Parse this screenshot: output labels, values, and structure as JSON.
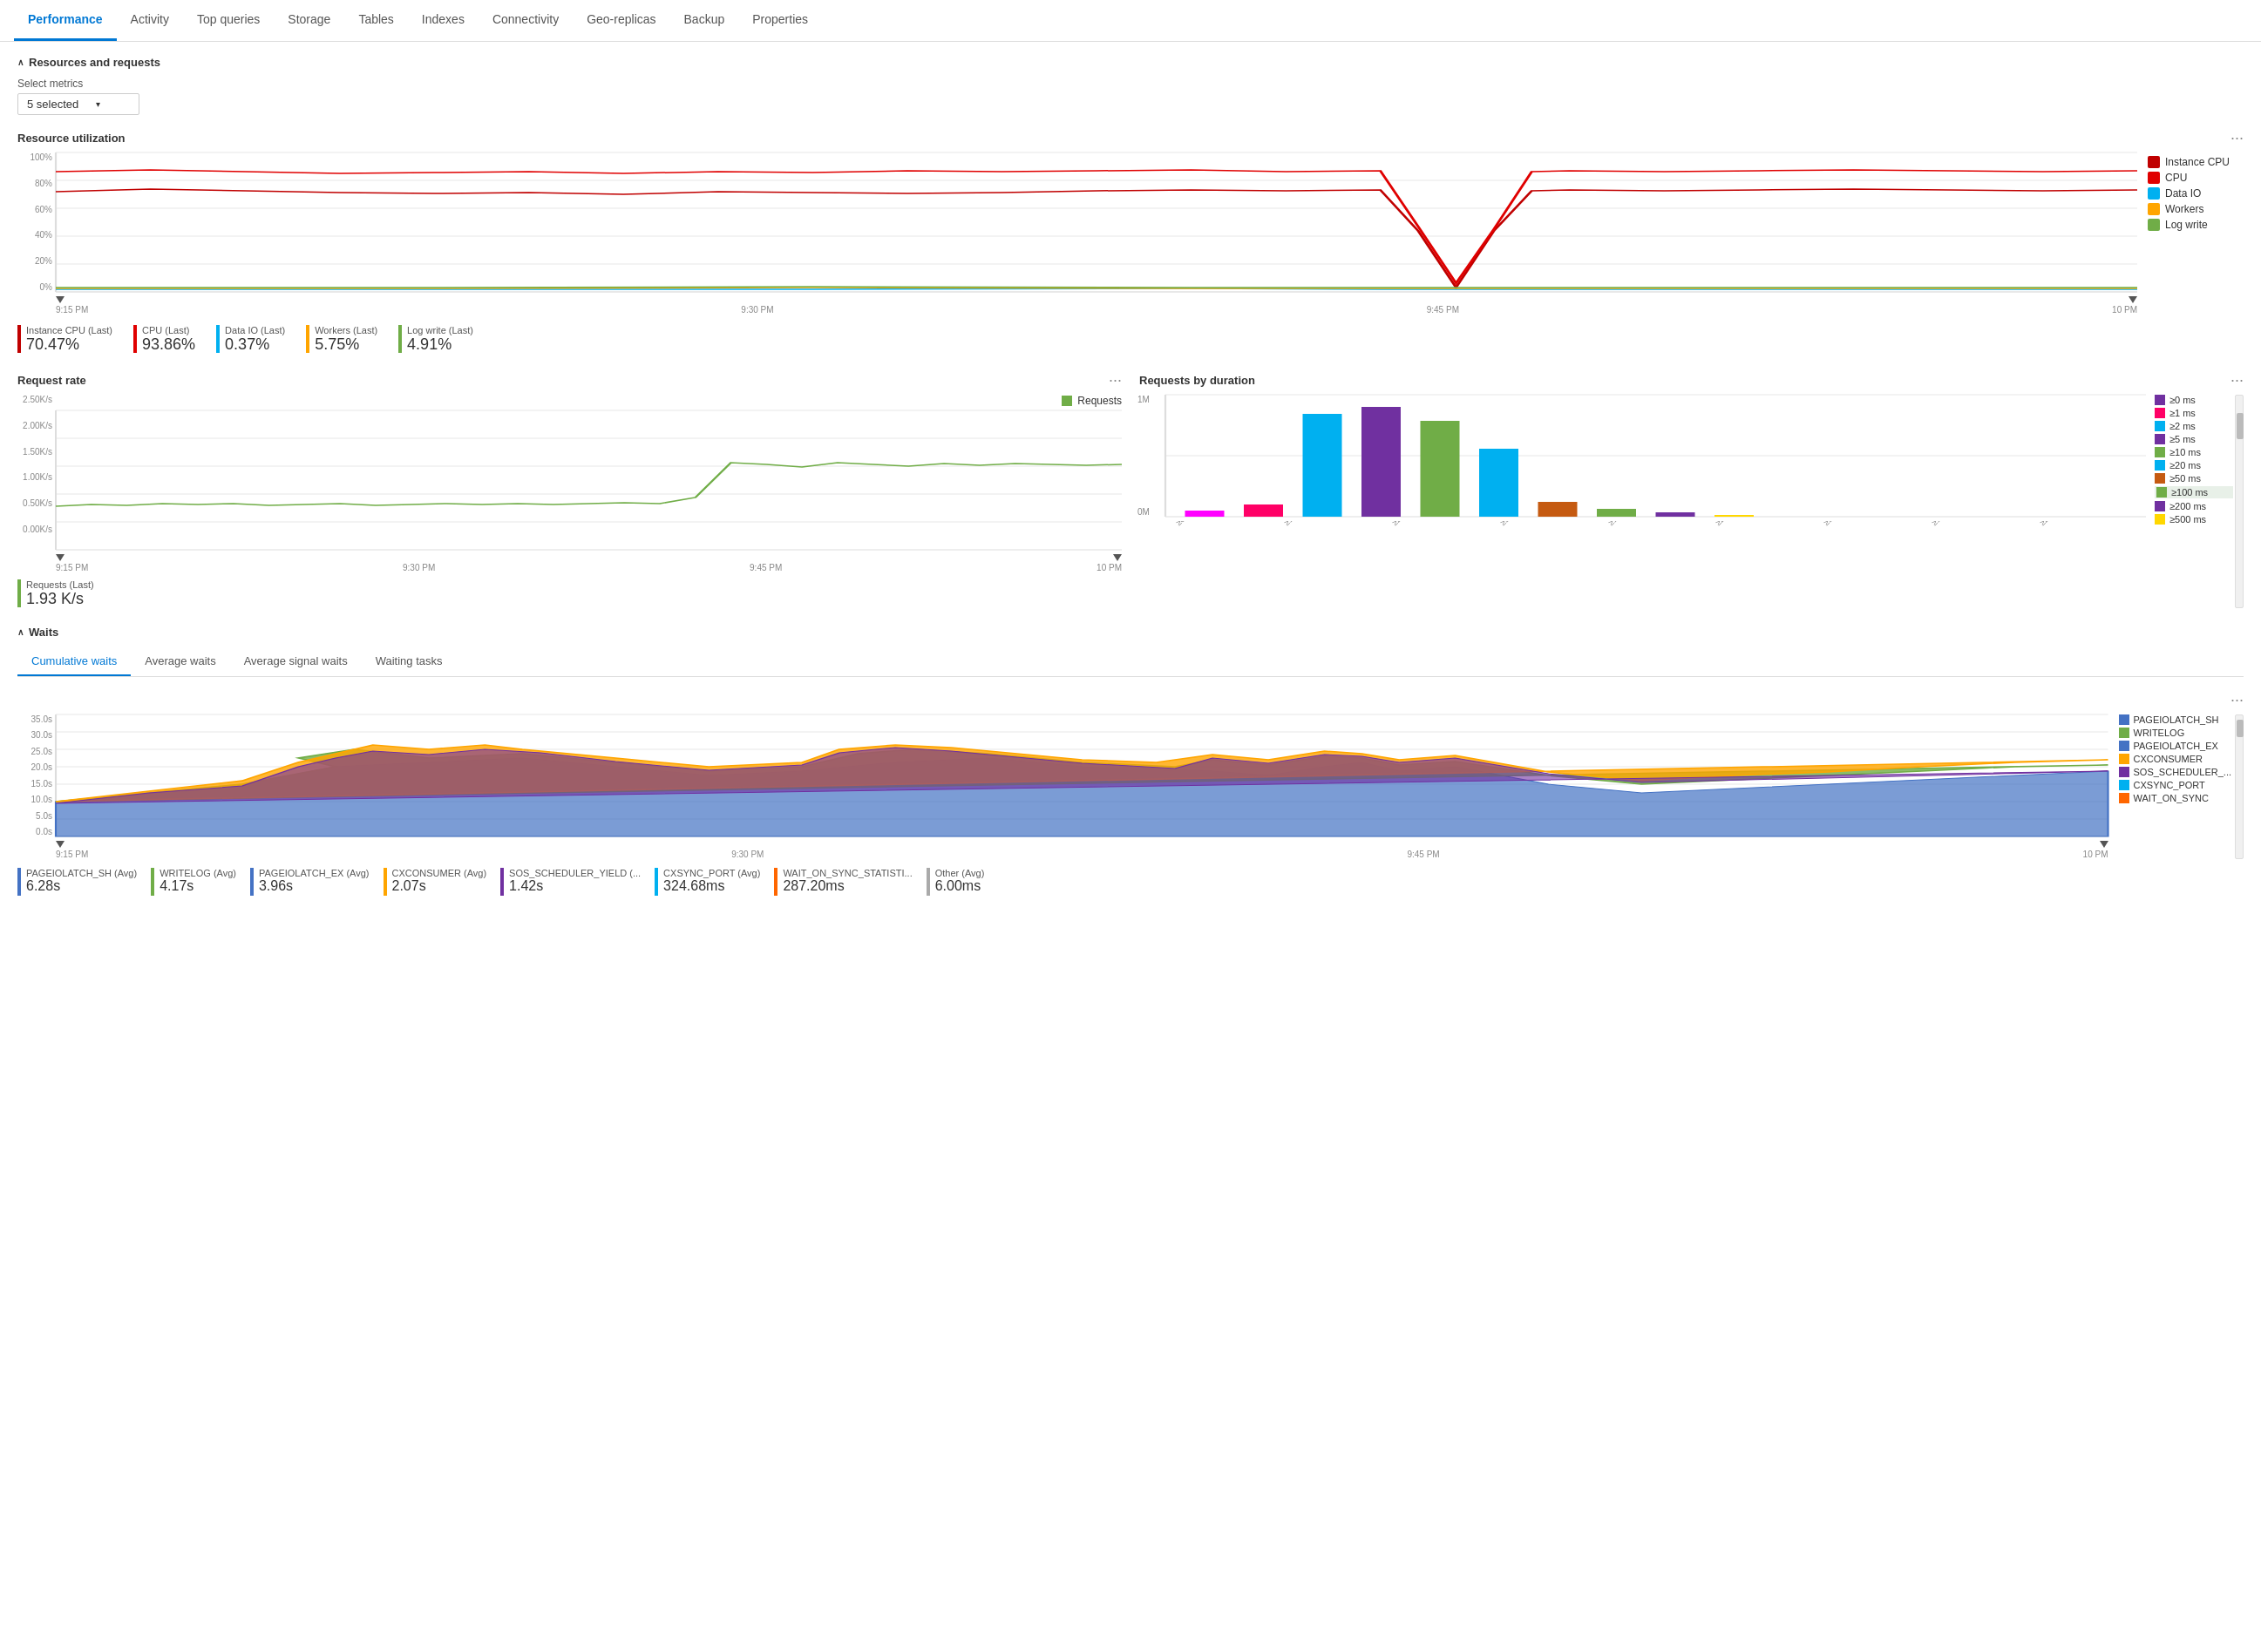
{
  "nav": {
    "tabs": [
      {
        "label": "Performance",
        "active": true
      },
      {
        "label": "Activity",
        "active": false
      },
      {
        "label": "Top queries",
        "active": false
      },
      {
        "label": "Storage",
        "active": false
      },
      {
        "label": "Tables",
        "active": false
      },
      {
        "label": "Indexes",
        "active": false
      },
      {
        "label": "Connectivity",
        "active": false
      },
      {
        "label": "Geo-replicas",
        "active": false
      },
      {
        "label": "Backup",
        "active": false
      },
      {
        "label": "Properties",
        "active": false
      }
    ]
  },
  "resources_section": {
    "title": "Resources and requests",
    "select_label": "Select metrics",
    "select_value": "5 selected"
  },
  "resource_utilization": {
    "title": "Resource utilization",
    "y_labels": [
      "100%",
      "80%",
      "60%",
      "40%",
      "20%",
      "0%"
    ],
    "x_labels": [
      "9:15 PM",
      "9:30 PM",
      "9:45 PM",
      "10 PM"
    ],
    "legend": [
      {
        "label": "Instance CPU",
        "color": "#c00000"
      },
      {
        "label": "CPU",
        "color": "#e00000"
      },
      {
        "label": "Data IO",
        "color": "#00b0f0"
      },
      {
        "label": "Workers",
        "color": "#ffa500"
      },
      {
        "label": "Log write",
        "color": "#70ad47"
      }
    ],
    "metrics": [
      {
        "label": "Instance CPU (Last)",
        "value": "70.47",
        "unit": "%",
        "color": "#c00000"
      },
      {
        "label": "CPU (Last)",
        "value": "93.86",
        "unit": "%",
        "color": "#e00000"
      },
      {
        "label": "Data IO (Last)",
        "value": "0.37",
        "unit": "%",
        "color": "#00b0f0"
      },
      {
        "label": "Workers (Last)",
        "value": "5.75",
        "unit": "%",
        "color": "#ffa500"
      },
      {
        "label": "Log write (Last)",
        "value": "4.91",
        "unit": "%",
        "color": "#70ad47"
      }
    ]
  },
  "request_rate": {
    "title": "Request rate",
    "y_labels": [
      "2.50K/s",
      "2.00K/s",
      "1.50K/s",
      "1.00K/s",
      "0.50K/s",
      "0.00K/s"
    ],
    "x_labels": [
      "9:15 PM",
      "9:30 PM",
      "9:45 PM",
      "10 PM"
    ],
    "legend_label": "Requests",
    "legend_color": "#70ad47",
    "metric_label": "Requests (Last)",
    "metric_value": "1.93 K/s",
    "metric_color": "#70ad47"
  },
  "requests_by_duration": {
    "title": "Requests by duration",
    "y_labels": [
      "1M",
      "0M"
    ],
    "x_labels": [
      "≥0 ms",
      "≥1 ms",
      "≥2 ms",
      "≥5 ms",
      "≥10 ms",
      "≥20 ms",
      "≥50 ms",
      "≥100 ms",
      "≥200 ms",
      "≥500 ms",
      "≥1 s",
      "≥2 s",
      "≥5 s",
      "≥10 s",
      "≥20 s",
      "≥50 s",
      "≥100 s"
    ],
    "legend": [
      {
        "label": "≥0 ms",
        "color": "#7030a0"
      },
      {
        "label": "≥1 ms",
        "color": "#ff0000"
      },
      {
        "label": "≥2 ms",
        "color": "#00b0f0"
      },
      {
        "label": "≥5 ms",
        "color": "#7030a0"
      },
      {
        "label": "≥10 ms",
        "color": "#70ad47"
      },
      {
        "label": "≥20 ms",
        "color": "#00b0f0"
      },
      {
        "label": "≥50 ms",
        "color": "#c55a11"
      },
      {
        "label": "≥100 ms",
        "color": "#70ad47"
      },
      {
        "label": "≥200 ms",
        "color": "#7030a0"
      },
      {
        "label": "≥500 ms",
        "color": "#ffd700"
      }
    ],
    "bars": [
      {
        "label": "≥0 ms",
        "height": 5,
        "color": "#ff00ff"
      },
      {
        "label": "≥1 ms",
        "height": 10,
        "color": "#ff0066"
      },
      {
        "label": "≥2 ms",
        "height": 85,
        "color": "#00b0f0"
      },
      {
        "label": "≥5 ms",
        "height": 90,
        "color": "#7030a0"
      },
      {
        "label": "≥10 ms",
        "height": 78,
        "color": "#70ad47"
      },
      {
        "label": "≥20 ms",
        "height": 55,
        "color": "#00b0f0"
      },
      {
        "label": "≥50 ms",
        "height": 12,
        "color": "#c55a11"
      },
      {
        "label": "≥100 ms",
        "height": 6,
        "color": "#70ad47"
      },
      {
        "label": "≥200 ms",
        "height": 3,
        "color": "#7030a0"
      },
      {
        "label": "≥500 ms",
        "height": 1,
        "color": "#ffd700"
      }
    ]
  },
  "waits_section": {
    "title": "Waits",
    "tabs": [
      "Cumulative waits",
      "Average waits",
      "Average signal waits",
      "Waiting tasks"
    ],
    "active_tab": 0,
    "y_labels": [
      "35.0s",
      "30.0s",
      "25.0s",
      "20.0s",
      "15.0s",
      "10.0s",
      "5.0s",
      "0.0s"
    ],
    "x_labels": [
      "9:15 PM",
      "9:30 PM",
      "9:45 PM",
      "10 PM"
    ],
    "legend": [
      {
        "label": "PAGEIOLATCH_SH",
        "color": "#4472c4"
      },
      {
        "label": "WRITELOG",
        "color": "#70ad47"
      },
      {
        "label": "PAGEIOLATCH_EX",
        "color": "#4472c4"
      },
      {
        "label": "CXCONSUMER",
        "color": "#ffa500"
      },
      {
        "label": "SOS_SCHEDULER_...",
        "color": "#7030a0"
      },
      {
        "label": "CXSYNC_PORT",
        "color": "#00b0f0"
      },
      {
        "label": "WAIT_ON_SYNC",
        "color": "#ff0000"
      }
    ],
    "metrics": [
      {
        "label": "PAGEIOLATCH_SH (Avg)",
        "value": "6.28",
        "unit": "s",
        "color": "#4472c4"
      },
      {
        "label": "WRITELOG (Avg)",
        "value": "4.17",
        "unit": "s",
        "color": "#70ad47"
      },
      {
        "label": "PAGEIOLATCH_EX (Avg)",
        "value": "3.96",
        "unit": "s",
        "color": "#4472c4"
      },
      {
        "label": "CXCONSUMER (Avg)",
        "value": "2.07",
        "unit": "s",
        "color": "#ffa500"
      },
      {
        "label": "SOS_SCHEDULER_YIELD (...",
        "value": "1.42",
        "unit": "s",
        "color": "#7030a0"
      },
      {
        "label": "CXSYNC_PORT (Avg)",
        "value": "324.68",
        "unit": "ms",
        "color": "#00b0f0"
      },
      {
        "label": "WAIT_ON_SYNC_STATISTI...",
        "value": "287.20",
        "unit": "ms",
        "color": "#ff6600"
      },
      {
        "label": "Other (Avg)",
        "value": "6.00",
        "unit": "ms",
        "color": "#aaa"
      }
    ]
  }
}
